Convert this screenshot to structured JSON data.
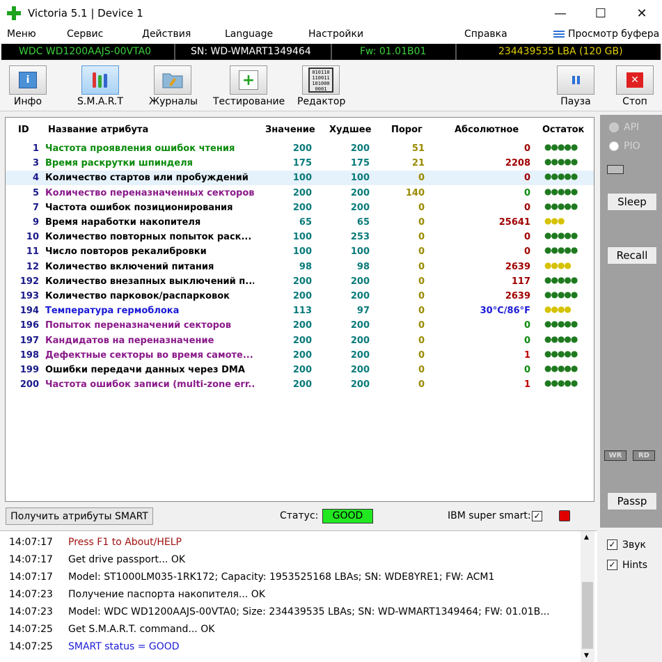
{
  "window": {
    "title": "Victoria 5.1 | Device 1",
    "minimize": "—",
    "maximize": "☐",
    "close": "✕"
  },
  "menu": {
    "items": [
      "Меню",
      "Сервис",
      "Действия",
      "Language",
      "Настройки",
      "Справка"
    ],
    "buffer_view": "Просмотр буфера"
  },
  "drive": {
    "model": "WDC WD1200AAJS-00VTA0",
    "serial": "SN: WD-WMART1349464",
    "firmware": "Fw: 01.01B01",
    "capacity": "234439535 LBA (120 GB)"
  },
  "toolbar": {
    "info": "Инфо",
    "smart": "S.M.A.R.T",
    "logs": "Журналы",
    "testing": "Тестирование",
    "editor": "Редактор",
    "pause": "Пауза",
    "stop": "Стоп",
    "editor_icon_text": "010110\n110011\n101000\n0001"
  },
  "table": {
    "columns": [
      "ID",
      "Название атрибута",
      "Значение",
      "Худшее",
      "Порог",
      "Абсолютное",
      "Остаток"
    ],
    "rows": [
      {
        "id": "1",
        "name": "Частота проявления ошибок чтения",
        "value": "200",
        "worst": "200",
        "threshold": "51",
        "raw": "0",
        "dots": "●●●●●",
        "name_color": "#0a8a0a",
        "thr_color": "#9a8a00",
        "raw_color": "#a00000",
        "dot_color": "#1f7a1f"
      },
      {
        "id": "3",
        "name": "Время раскрутки шпинделя",
        "value": "175",
        "worst": "175",
        "threshold": "21",
        "raw": "2208",
        "dots": "●●●●●",
        "name_color": "#0a8a0a",
        "thr_color": "#9a8a00",
        "raw_color": "#a00000",
        "dot_color": "#1f7a1f"
      },
      {
        "id": "4",
        "name": "Количество стартов или пробуждений",
        "value": "100",
        "worst": "100",
        "threshold": "0",
        "raw": "0",
        "dots": "●●●●●",
        "name_color": "#000000",
        "thr_color": "#9a8a00",
        "raw_color": "#a00000",
        "dot_color": "#1f7a1f"
      },
      {
        "id": "5",
        "name": "Количество переназначенных секторов",
        "value": "200",
        "worst": "200",
        "threshold": "140",
        "raw": "0",
        "dots": "●●●●●",
        "name_color": "#8a1a8a",
        "thr_color": "#9a8a00",
        "raw_color": "#0a8a0a",
        "dot_color": "#1f7a1f"
      },
      {
        "id": "7",
        "name": "Частота ошибок позиционирования",
        "value": "200",
        "worst": "200",
        "threshold": "0",
        "raw": "0",
        "dots": "●●●●●",
        "name_color": "#000000",
        "thr_color": "#9a8a00",
        "raw_color": "#a00000",
        "dot_color": "#1f7a1f"
      },
      {
        "id": "9",
        "name": "Время наработки накопителя",
        "value": "65",
        "worst": "65",
        "threshold": "0",
        "raw": "25641",
        "dots": "●●●",
        "name_color": "#000000",
        "thr_color": "#9a8a00",
        "raw_color": "#a00000",
        "dot_color": "#d6c200"
      },
      {
        "id": "10",
        "name": "Количество повторных попыток раск...",
        "value": "100",
        "worst": "253",
        "threshold": "0",
        "raw": "0",
        "dots": "●●●●●",
        "name_color": "#000000",
        "thr_color": "#9a8a00",
        "raw_color": "#a00000",
        "dot_color": "#1f7a1f"
      },
      {
        "id": "11",
        "name": "Число повторов рекалибровки",
        "value": "100",
        "worst": "100",
        "threshold": "0",
        "raw": "0",
        "dots": "●●●●●",
        "name_color": "#000000",
        "thr_color": "#9a8a00",
        "raw_color": "#a00000",
        "dot_color": "#1f7a1f"
      },
      {
        "id": "12",
        "name": "Количество включений питания",
        "value": "98",
        "worst": "98",
        "threshold": "0",
        "raw": "2639",
        "dots": "●●●●",
        "name_color": "#000000",
        "thr_color": "#9a8a00",
        "raw_color": "#a00000",
        "dot_color": "#d6c200"
      },
      {
        "id": "192",
        "name": "Количество внезапных выключений п...",
        "value": "200",
        "worst": "200",
        "threshold": "0",
        "raw": "117",
        "dots": "●●●●●",
        "name_color": "#000000",
        "thr_color": "#9a8a00",
        "raw_color": "#a00000",
        "dot_color": "#1f7a1f"
      },
      {
        "id": "193",
        "name": "Количество парковок/распарковок",
        "value": "200",
        "worst": "200",
        "threshold": "0",
        "raw": "2639",
        "dots": "●●●●●",
        "name_color": "#000000",
        "thr_color": "#9a8a00",
        "raw_color": "#a00000",
        "dot_color": "#1f7a1f"
      },
      {
        "id": "194",
        "name": "Температура гермоблока",
        "value": "113",
        "worst": "97",
        "threshold": "0",
        "raw": "30°C/86°F",
        "dots": "●●●●",
        "name_color": "#1a1ad6",
        "thr_color": "#9a8a00",
        "raw_color": "#1a1ad6",
        "dot_color": "#d6c200"
      },
      {
        "id": "196",
        "name": "Попыток переназначений секторов",
        "value": "200",
        "worst": "200",
        "threshold": "0",
        "raw": "0",
        "dots": "●●●●●",
        "name_color": "#8a1a8a",
        "thr_color": "#9a8a00",
        "raw_color": "#0a8a0a",
        "dot_color": "#1f7a1f"
      },
      {
        "id": "197",
        "name": "Кандидатов на переназначение",
        "value": "200",
        "worst": "200",
        "threshold": "0",
        "raw": "0",
        "dots": "●●●●●",
        "name_color": "#8a1a8a",
        "thr_color": "#9a8a00",
        "raw_color": "#0a8a0a",
        "dot_color": "#1f7a1f"
      },
      {
        "id": "198",
        "name": "Дефектные секторы во время самоте...",
        "value": "200",
        "worst": "200",
        "threshold": "0",
        "raw": "1",
        "dots": "●●●●●",
        "name_color": "#8a1a8a",
        "thr_color": "#9a8a00",
        "raw_color": "#c00000",
        "dot_color": "#1f7a1f"
      },
      {
        "id": "199",
        "name": "Ошибки передачи данных через DMA",
        "value": "200",
        "worst": "200",
        "threshold": "0",
        "raw": "0",
        "dots": "●●●●●",
        "name_color": "#000000",
        "thr_color": "#9a8a00",
        "raw_color": "#0a8a0a",
        "dot_color": "#1f7a1f"
      },
      {
        "id": "200",
        "name": "Частота ошибок записи (multi-zone err...",
        "value": "200",
        "worst": "200",
        "threshold": "0",
        "raw": "1",
        "dots": "●●●●●",
        "name_color": "#8a1a8a",
        "thr_color": "#9a8a00",
        "raw_color": "#c00000",
        "dot_color": "#1f7a1f"
      }
    ]
  },
  "side": {
    "api": "API",
    "pio": "PIO",
    "sleep": "Sleep",
    "recall": "Recall",
    "wr": "WR",
    "rd": "RD",
    "passp": "Passp"
  },
  "status": {
    "get_button": "Получить атрибуты SMART",
    "label": "Статус:",
    "value": "GOOD",
    "ibm_label": "IBM super smart:",
    "ibm_checked": "✓"
  },
  "log": [
    {
      "time": "14:07:17",
      "msg": "Press F1 to About/HELP",
      "color": "#a01010"
    },
    {
      "time": "14:07:17",
      "msg": "Get drive passport... OK",
      "color": "#000000"
    },
    {
      "time": "14:07:17",
      "msg": "Model: ST1000LM035-1RK172; Capacity: 1953525168 LBAs; SN: WDE8YRE1; FW: ACM1",
      "color": "#000000"
    },
    {
      "time": "14:07:23",
      "msg": "Получение паспорта накопителя... OK",
      "color": "#000000"
    },
    {
      "time": "14:07:23",
      "msg": "Model: WDC WD1200AAJS-00VTA0; Size: 234439535 LBAs; SN: WD-WMART1349464; FW: 01.01B...",
      "color": "#000000"
    },
    {
      "time": "14:07:25",
      "msg": "Get S.M.A.R.T. command... OK",
      "color": "#000000"
    },
    {
      "time": "14:07:25",
      "msg": "SMART status = GOOD",
      "color": "#1a1ad6"
    }
  ],
  "options": {
    "sound": "Звук",
    "hints": "Hints",
    "check": "✓"
  },
  "colors": {
    "drive_model": "#3ad13a",
    "drive_serial": "#ffffff",
    "drive_fw": "#3ad13a",
    "drive_capacity": "#e0d000",
    "id_color": "#1a1a8a",
    "value_color": "#0a7a7a"
  }
}
